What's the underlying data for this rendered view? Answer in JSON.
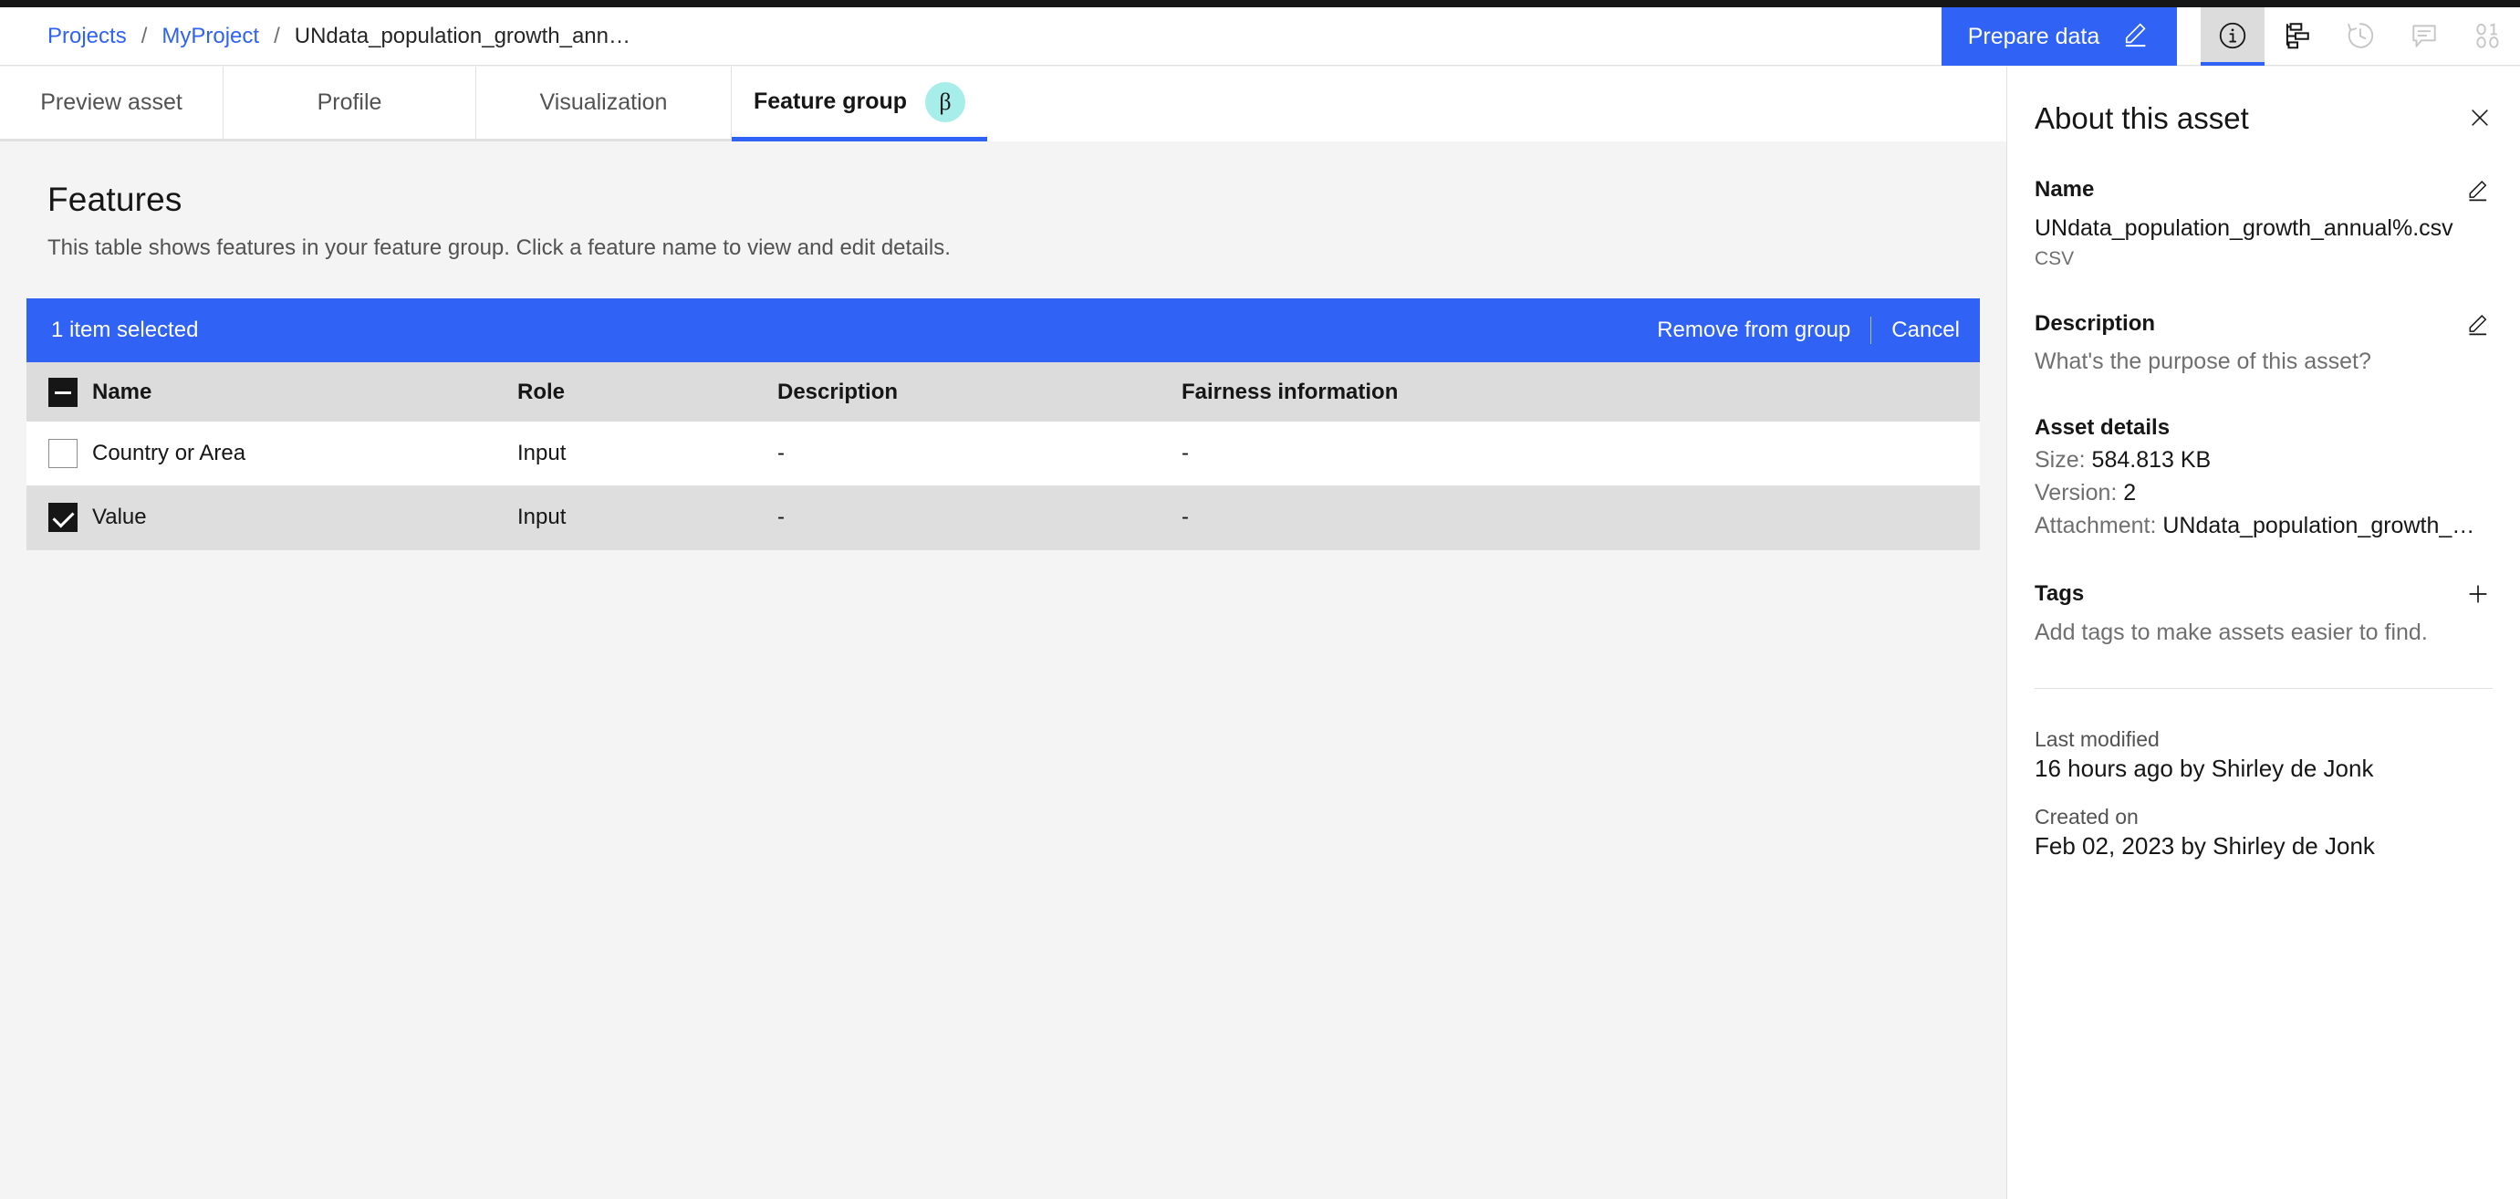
{
  "header": {
    "breadcrumb": {
      "items": [
        {
          "label": "Projects",
          "type": "link"
        },
        {
          "label": "MyProject",
          "type": "link"
        },
        {
          "label": "UNdata_population_growth_ann…",
          "type": "current"
        }
      ],
      "separator": "/"
    },
    "prepare_button": {
      "label": "Prepare data",
      "icon": "edit-pencil-icon"
    },
    "icons": [
      {
        "name": "info-icon",
        "active": true,
        "enabled": true
      },
      {
        "name": "lineage-icon",
        "active": false,
        "enabled": true
      },
      {
        "name": "history-clock-icon",
        "active": false,
        "enabled": false
      },
      {
        "name": "comment-icon",
        "active": false,
        "enabled": false
      },
      {
        "name": "binary-code-icon",
        "active": false,
        "enabled": false
      }
    ]
  },
  "tabs": [
    {
      "label": "Preview asset",
      "active": false,
      "badge": null
    },
    {
      "label": "Profile",
      "active": false,
      "badge": null
    },
    {
      "label": "Visualization",
      "active": false,
      "badge": null
    },
    {
      "label": "Feature group",
      "active": true,
      "badge": "β"
    }
  ],
  "main": {
    "title": "Features",
    "subtitle": "This table shows features in your feature group. Click a feature name to view and edit details.",
    "selection_banner": {
      "count_label": "1 item selected",
      "remove_label": "Remove from group",
      "cancel_label": "Cancel"
    },
    "table": {
      "columns": [
        "Name",
        "Role",
        "Description",
        "Fairness information"
      ],
      "header_checkbox_state": "indeterminate",
      "rows": [
        {
          "selected": false,
          "name": "Country or Area",
          "role": "Input",
          "description": "-",
          "fairness": "-"
        },
        {
          "selected": true,
          "name": "Value",
          "role": "Input",
          "description": "-",
          "fairness": "-"
        }
      ]
    }
  },
  "panel": {
    "title": "About this asset",
    "close_icon": "close-icon",
    "name_section": {
      "heading": "Name",
      "edit_icon": "edit-pencil-icon",
      "value": "UNdata_population_growth_annual%.csv",
      "format": "CSV"
    },
    "description_section": {
      "heading": "Description",
      "edit_icon": "edit-pencil-icon",
      "placeholder": "What's the purpose of this asset?"
    },
    "asset_details": {
      "heading": "Asset details",
      "size_label": "Size:",
      "size_value": "584.813 KB",
      "version_label": "Version:",
      "version_value": "2",
      "attachment_label": "Attachment:",
      "attachment_value": "UNdata_population_growth_…"
    },
    "tags_section": {
      "heading": "Tags",
      "add_icon": "plus-icon",
      "placeholder": "Add tags to make assets easier to find."
    },
    "last_modified": {
      "label": "Last modified",
      "value": "16 hours ago by Shirley de Jonk"
    },
    "created_on": {
      "label": "Created on",
      "value": "Feb 02, 2023 by Shirley de Jonk"
    }
  },
  "colors": {
    "accent_blue": "#2f62f5",
    "beta_badge": "#a7eeea",
    "header_row": "#dcdcdc",
    "selected_row": "#dedede",
    "page_bg": "#f4f4f4"
  }
}
